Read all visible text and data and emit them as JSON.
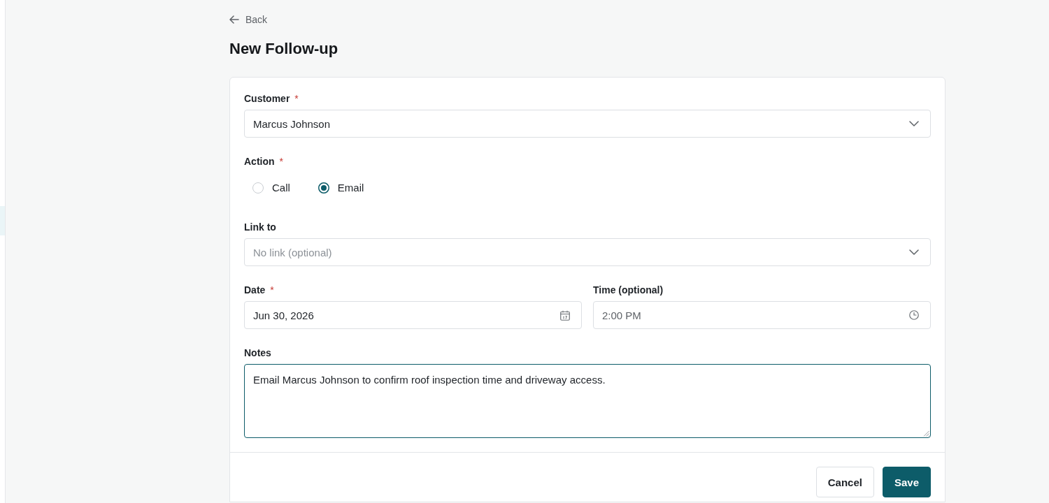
{
  "back_link": {
    "label": "Back"
  },
  "page_title": "New Follow-up",
  "form": {
    "fields": [
      {
        "kind": "select",
        "label": "Customer",
        "required_mark": "*",
        "value": "Marcus Johnson"
      },
      {
        "kind": "radio",
        "label": "Action",
        "required_mark": "*",
        "options": [
          {
            "label": "Call",
            "selected": false
          },
          {
            "label": "Email",
            "selected": true
          }
        ]
      },
      {
        "kind": "select",
        "label": "Link to",
        "placeholder": "No link (optional)"
      },
      {
        "kind": "row",
        "fields": [
          {
            "kind": "date",
            "label": "Date",
            "required_mark": "*",
            "value": "Jun 30, 2026"
          },
          {
            "kind": "time",
            "label": "Time (optional)",
            "value": "2:00 PM"
          }
        ]
      },
      {
        "kind": "textarea",
        "label": "Notes",
        "value": "Email Marcus Johnson to confirm roof inspection time and driveway access.",
        "focused": true
      }
    ]
  },
  "buttons": [
    {
      "label": "Cancel",
      "kind": "secondary"
    },
    {
      "label": "Save",
      "kind": "primary"
    }
  ]
}
